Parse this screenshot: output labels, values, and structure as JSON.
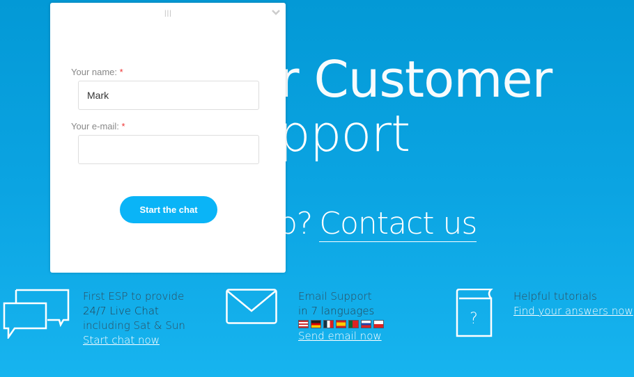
{
  "hero": {
    "line1": "r Customer",
    "line2": "pport",
    "line3_prefix": "o?",
    "contact_link": "Contact us"
  },
  "chat_form": {
    "name_label": "Your name:",
    "required_mark": "*",
    "name_value": "Mark",
    "email_label": "Your e-mail:",
    "email_value": "",
    "start_button": "Start the chat"
  },
  "features": [
    {
      "line1": "First ESP to provide",
      "line2": "24/7 Live Chat",
      "line3": "including Sat & Sun",
      "link": "Start chat now",
      "icon": "chat-bubbles-icon"
    },
    {
      "line1": "Email Support",
      "line2": "in 7 languages",
      "link": "Send email now",
      "icon": "envelope-icon",
      "flags": [
        "us",
        "de",
        "fr",
        "es",
        "pt",
        "ru",
        "pl"
      ]
    },
    {
      "line1": "Helpful tutorials",
      "link": "Find your answers now",
      "icon": "book-question-icon"
    }
  ],
  "colors": {
    "accent": "#0ab4f7",
    "background_top": "#0399d6",
    "background_bottom": "#17b4ef"
  }
}
